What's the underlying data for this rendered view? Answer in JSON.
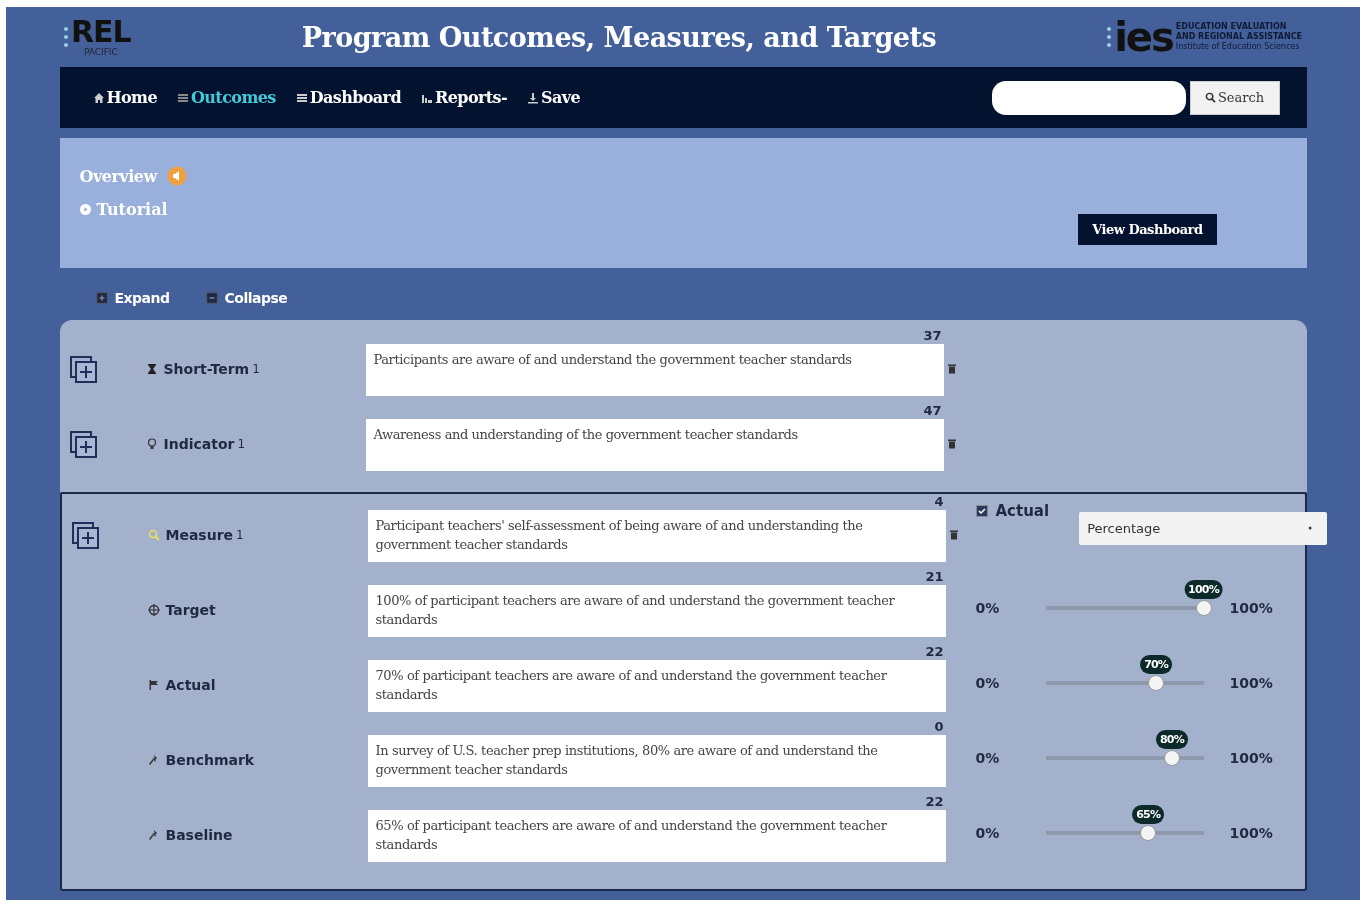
{
  "header": {
    "logo_left": {
      "mark": "REL",
      "sub": "PACIFIC"
    },
    "title": "Program Outcomes, Measures, and Targets",
    "logo_right": {
      "mark": "ies",
      "line1": "EDUCATION EVALUATION",
      "line2": "AND REGIONAL ASSISTANCE",
      "line3": "Institute of Education Sciences"
    }
  },
  "nav": {
    "items": [
      {
        "kind": "home",
        "label": "Home",
        "selected": false
      },
      {
        "kind": "outcomes",
        "label": "Outcomes",
        "selected": true
      },
      {
        "kind": "dashboard",
        "label": "Dashboard",
        "selected": false
      },
      {
        "kind": "reports",
        "label": "Reports-",
        "selected": false
      },
      {
        "kind": "save",
        "label": "Save",
        "selected": false
      }
    ],
    "search": {
      "button": "Search"
    }
  },
  "overview": {
    "title": "Overview",
    "tutorial": "Tutorial",
    "button": "View Dashboard"
  },
  "toolbar": {
    "expand": "Expand",
    "collapse": "Collapse"
  },
  "outcome_rows": [
    {
      "kind": "short-term",
      "label": "Short-Term",
      "number": "1",
      "count": "37",
      "text": "Participants are aware of and understand the government teacher standards"
    },
    {
      "kind": "indicator",
      "label": "Indicator",
      "number": "1",
      "count": "47",
      "text": "Awareness and understanding of the government teacher standards"
    }
  ],
  "measure": {
    "kind": "measure",
    "label": "Measure",
    "number": "1",
    "count": "4",
    "text": "Participant teachers' self-assessment of being aware of and understanding the government teacher standards",
    "actual": {
      "label": "Actual",
      "checked": true
    },
    "unit": "Percentage",
    "rows": [
      {
        "kind": "target",
        "label": "Target",
        "count": "21",
        "text": "100% of participant teachers are aware of and understand the government teacher standards",
        "min": "0%",
        "max": "100%",
        "level": 1.0,
        "bubble": "100%"
      },
      {
        "kind": "actual",
        "label": "Actual",
        "count": "22",
        "text": "70% of participant teachers are aware of and understand the government teacher standards",
        "min": "0%",
        "max": "100%",
        "level": 0.7,
        "bubble": "70%"
      },
      {
        "kind": "benchmark",
        "label": "Benchmark",
        "count": "0",
        "text": "In survey of U.S. teacher prep institutions, 80% are aware of and understand the government teacher standards",
        "min": "0%",
        "max": "100%",
        "level": 0.8,
        "bubble": "80%"
      },
      {
        "kind": "baseline",
        "label": "Baseline",
        "count": "22",
        "text": "65% of participant teachers are aware of and understand the government teacher standards",
        "min": "0%",
        "max": "100%",
        "level": 0.65,
        "bubble": "65%"
      }
    ]
  }
}
